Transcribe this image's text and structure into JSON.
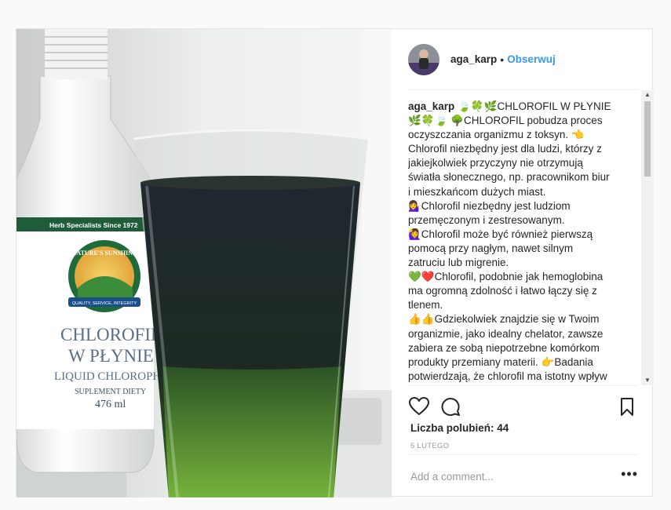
{
  "post": {
    "username": "aga_karp",
    "separator": "•",
    "follow_label": "Obserwuj",
    "caption": {
      "username": "aga_karp",
      "lines": [
        "🍃🍀🌿CHLOROFIL W PŁYNIE",
        "🌿🍀🍃 🌳CHLOROFIL pobudza proces",
        "oczyszczania organizmu z toksyn. 👈",
        "Chlorofil niezbędny jest dla ludzi, którzy z",
        "jakiejkolwiek przyczyny nie otrzymują",
        "światła słonecznego, np. pracownikom biur",
        "i mieszkańcom dużych miast.",
        "💁‍♀️Chlorofil niezbędny jest ludziom",
        "przemęczonym i zestresowanym.",
        "🙋‍♀️Chlorofil może być również pierwszą",
        "pomocą przy nagłym, nawet silnym",
        "zatruciu lub migrenie.",
        "💚❤️Chlorofil, podobnie jak hemoglobina",
        "ma ogromną zdolność i łatwo łączy się z",
        "tlenem.",
        "👍👍Gdziekolwiek znajdzie się w Twoim",
        "organizmie, jako idealny chelator, zawsze",
        "zabiera ze sobą niepotrzebne komórkom",
        "produkty przemiany materii. 👉Badania",
        "potwierdzają, że chlorofil ma istotny wpływ"
      ]
    },
    "likes_text": "Liczba polubień: 44",
    "date": "5 LUTEGO",
    "comment_placeholder": "Add a comment...",
    "more_label": "•••",
    "icons": {
      "like": "heart-icon",
      "comment": "comment-icon",
      "save": "bookmark-icon",
      "more": "more-options-icon"
    }
  },
  "photo": {
    "bottle": {
      "banner": "Herb Specialists Since 1972",
      "brand": "NATURE'S SUNSHINE",
      "tagline": "QUALITY, SERVICE, INTEGRITY",
      "title_line1": "CHLOROFIL",
      "title_line2": "W PŁYNIE",
      "subtitle": "LIQUID CHLOROPHYLL",
      "supplement": "SUPLEMENT DIETY",
      "volume": "476 ml"
    }
  },
  "colors": {
    "link": "#3897f0",
    "text": "#262626",
    "muted": "#999999",
    "liquid": "#1e2a24"
  }
}
